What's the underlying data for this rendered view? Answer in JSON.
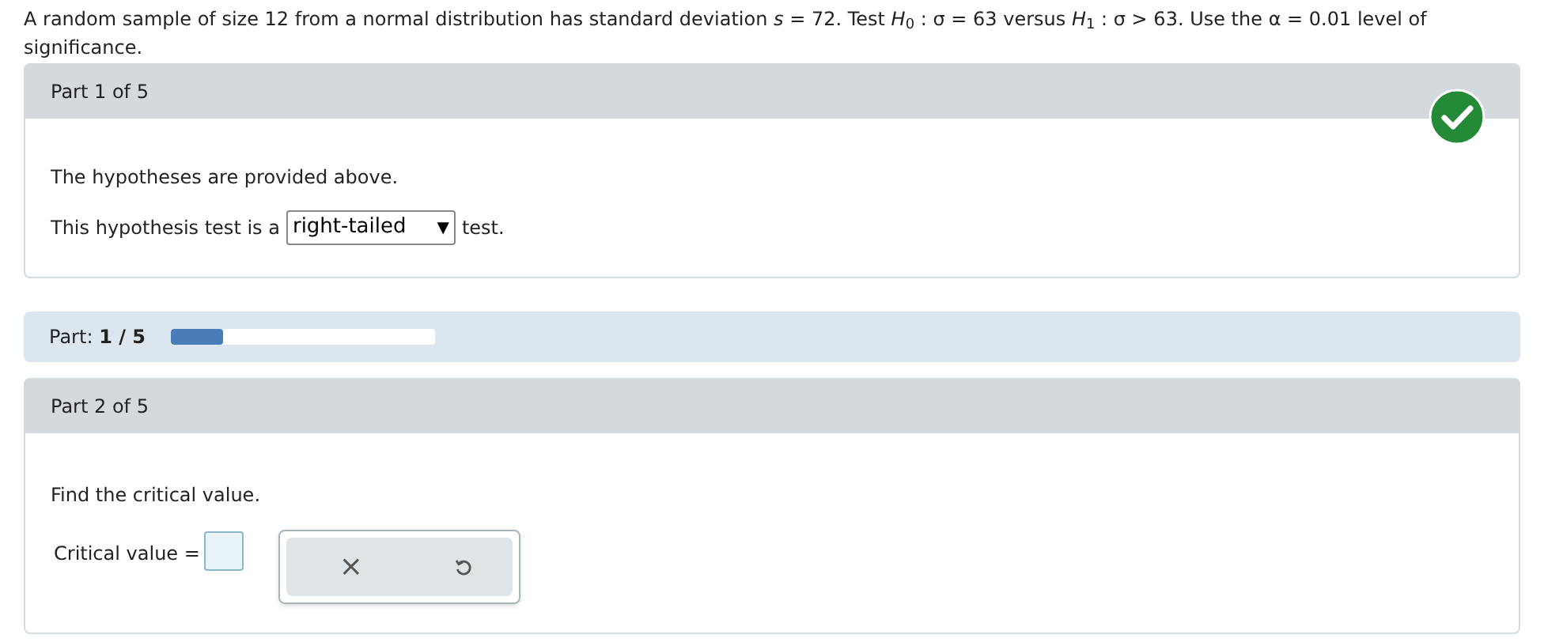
{
  "question": "A random sample of size 12 from a normal distribution has standard deviation *s* = 72. Test *H*$_{0}$ : σ = 63 versus *H*$_{1}$ : σ > 63. Use the α = 0.01 level of significance.",
  "part1": {
    "title": "Part 1 of 5",
    "correct": true,
    "line1": "The hypotheses are provided above.",
    "prefix": "This hypothesis test is a",
    "dropdown": {
      "value": "right-tailed",
      "arrow": "▼"
    },
    "suffix": "test."
  },
  "progress": {
    "label": "Part:",
    "value": "1 / 5",
    "level": 0.2
  },
  "part2": {
    "title": "Part 2 of 5",
    "prompt": "Find the critical value.",
    "label": "Critical value =",
    "buttons": [
      "×"
    ]
  }
}
